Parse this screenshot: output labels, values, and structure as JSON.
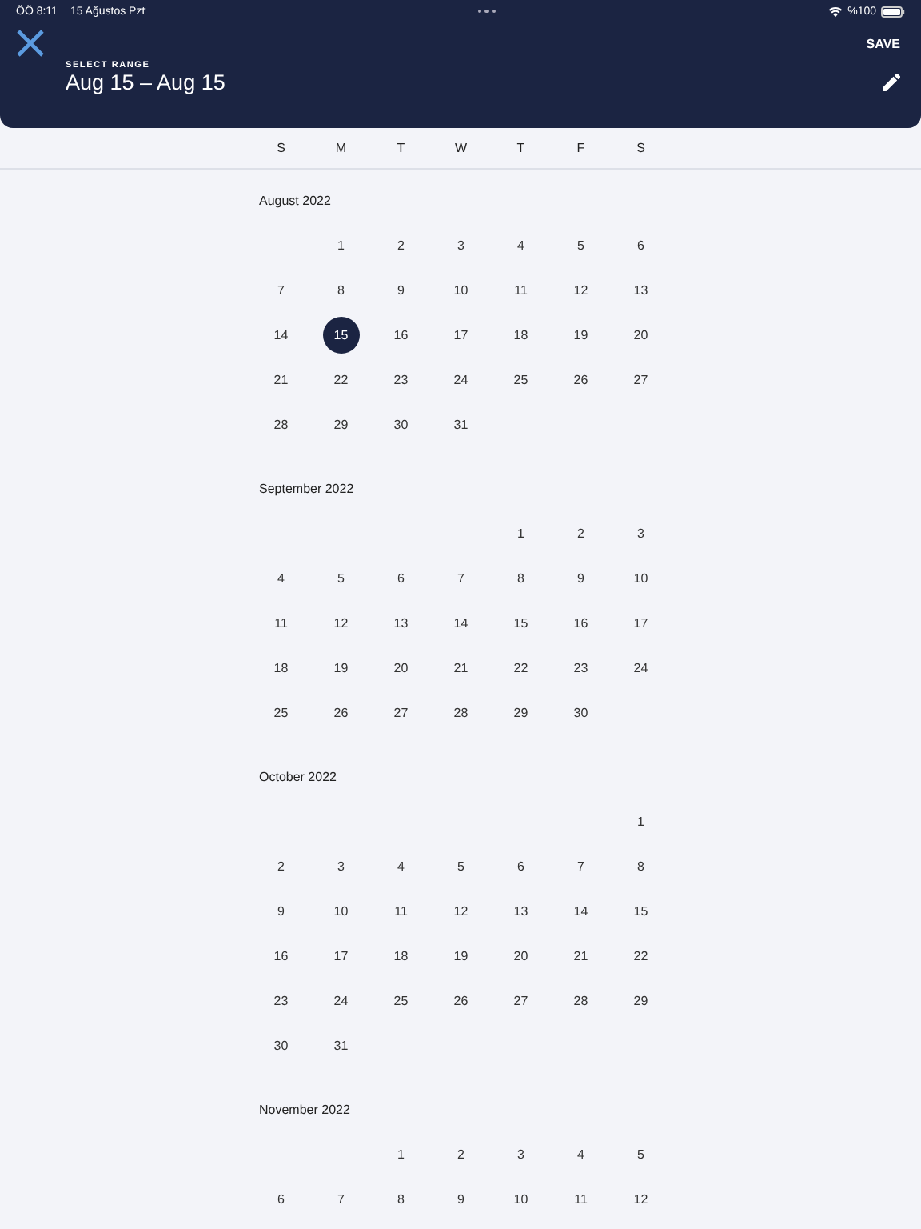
{
  "status_bar": {
    "time": "ÖÖ 8:11",
    "date": "15 Ağustos Pzt",
    "battery": "%100"
  },
  "header": {
    "action": "SAVE",
    "label": "SELECT RANGE",
    "range": "Aug 15 – Aug 15"
  },
  "weekdays": [
    "S",
    "M",
    "T",
    "W",
    "T",
    "F",
    "S"
  ],
  "months": [
    {
      "title": "August 2022",
      "weeks": [
        [
          {
            "d": "1",
            "selected": false
          },
          {
            "d": "2",
            "selected": false
          },
          {
            "d": "3",
            "selected": false
          },
          {
            "d": "4",
            "selected": false
          },
          {
            "d": "5",
            "selected": false
          },
          {
            "d": "6",
            "selected": false
          }
        ],
        [
          {
            "d": "7",
            "selected": false
          },
          {
            "d": "8",
            "selected": false
          },
          {
            "d": "9",
            "selected": false
          },
          {
            "d": "10",
            "selected": false
          },
          {
            "d": "11",
            "selected": false
          },
          {
            "d": "12",
            "selected": false
          },
          {
            "d": "13",
            "selected": false
          }
        ],
        [
          {
            "d": "14",
            "selected": false
          },
          {
            "d": "15",
            "selected": true
          },
          {
            "d": "16",
            "selected": false
          },
          {
            "d": "17",
            "selected": false
          },
          {
            "d": "18",
            "selected": false
          },
          {
            "d": "19",
            "selected": false
          },
          {
            "d": "20",
            "selected": false
          }
        ],
        [
          {
            "d": "21",
            "selected": false
          },
          {
            "d": "22",
            "selected": false
          },
          {
            "d": "23",
            "selected": false
          },
          {
            "d": "24",
            "selected": false
          },
          {
            "d": "25",
            "selected": false
          },
          {
            "d": "26",
            "selected": false
          },
          {
            "d": "27",
            "selected": false
          }
        ],
        [
          {
            "d": "28",
            "selected": false
          },
          {
            "d": "29",
            "selected": false
          },
          {
            "d": "30",
            "selected": false
          },
          {
            "d": "31",
            "selected": false
          }
        ]
      ]
    },
    {
      "title": "September 2022",
      "weeks": [
        [
          {
            "d": "1",
            "selected": false
          },
          {
            "d": "2",
            "selected": false
          },
          {
            "d": "3",
            "selected": false
          }
        ],
        [
          {
            "d": "4",
            "selected": false
          },
          {
            "d": "5",
            "selected": false
          },
          {
            "d": "6",
            "selected": false
          },
          {
            "d": "7",
            "selected": false
          },
          {
            "d": "8",
            "selected": false
          },
          {
            "d": "9",
            "selected": false
          },
          {
            "d": "10",
            "selected": false
          }
        ],
        [
          {
            "d": "11",
            "selected": false
          },
          {
            "d": "12",
            "selected": false
          },
          {
            "d": "13",
            "selected": false
          },
          {
            "d": "14",
            "selected": false
          },
          {
            "d": "15",
            "selected": false
          },
          {
            "d": "16",
            "selected": false
          },
          {
            "d": "17",
            "selected": false
          }
        ],
        [
          {
            "d": "18",
            "selected": false
          },
          {
            "d": "19",
            "selected": false
          },
          {
            "d": "20",
            "selected": false
          },
          {
            "d": "21",
            "selected": false
          },
          {
            "d": "22",
            "selected": false
          },
          {
            "d": "23",
            "selected": false
          },
          {
            "d": "24",
            "selected": false
          }
        ],
        [
          {
            "d": "25",
            "selected": false
          },
          {
            "d": "26",
            "selected": false
          },
          {
            "d": "27",
            "selected": false
          },
          {
            "d": "28",
            "selected": false
          },
          {
            "d": "29",
            "selected": false
          },
          {
            "d": "30",
            "selected": false
          }
        ]
      ]
    },
    {
      "title": "October 2022",
      "weeks": [
        [
          {
            "d": "1",
            "selected": false
          }
        ],
        [
          {
            "d": "2",
            "selected": false
          },
          {
            "d": "3",
            "selected": false
          },
          {
            "d": "4",
            "selected": false
          },
          {
            "d": "5",
            "selected": false
          },
          {
            "d": "6",
            "selected": false
          },
          {
            "d": "7",
            "selected": false
          },
          {
            "d": "8",
            "selected": false
          }
        ],
        [
          {
            "d": "9",
            "selected": false
          },
          {
            "d": "10",
            "selected": false
          },
          {
            "d": "11",
            "selected": false
          },
          {
            "d": "12",
            "selected": false
          },
          {
            "d": "13",
            "selected": false
          },
          {
            "d": "14",
            "selected": false
          },
          {
            "d": "15",
            "selected": false
          }
        ],
        [
          {
            "d": "16",
            "selected": false
          },
          {
            "d": "17",
            "selected": false
          },
          {
            "d": "18",
            "selected": false
          },
          {
            "d": "19",
            "selected": false
          },
          {
            "d": "20",
            "selected": false
          },
          {
            "d": "21",
            "selected": false
          },
          {
            "d": "22",
            "selected": false
          }
        ],
        [
          {
            "d": "23",
            "selected": false
          },
          {
            "d": "24",
            "selected": false
          },
          {
            "d": "25",
            "selected": false
          },
          {
            "d": "26",
            "selected": false
          },
          {
            "d": "27",
            "selected": false
          },
          {
            "d": "28",
            "selected": false
          },
          {
            "d": "29",
            "selected": false
          }
        ],
        [
          {
            "d": "30",
            "selected": false
          },
          {
            "d": "31",
            "selected": false
          }
        ]
      ]
    },
    {
      "title": "November 2022",
      "weeks": [
        [
          {
            "d": "1",
            "selected": false
          },
          {
            "d": "2",
            "selected": false
          },
          {
            "d": "3",
            "selected": false
          },
          {
            "d": "4",
            "selected": false
          },
          {
            "d": "5",
            "selected": false
          }
        ],
        [
          {
            "d": "6",
            "selected": false
          },
          {
            "d": "7",
            "selected": false
          },
          {
            "d": "8",
            "selected": false
          },
          {
            "d": "9",
            "selected": false
          },
          {
            "d": "10",
            "selected": false
          },
          {
            "d": "11",
            "selected": false
          },
          {
            "d": "12",
            "selected": false
          }
        ]
      ]
    }
  ]
}
